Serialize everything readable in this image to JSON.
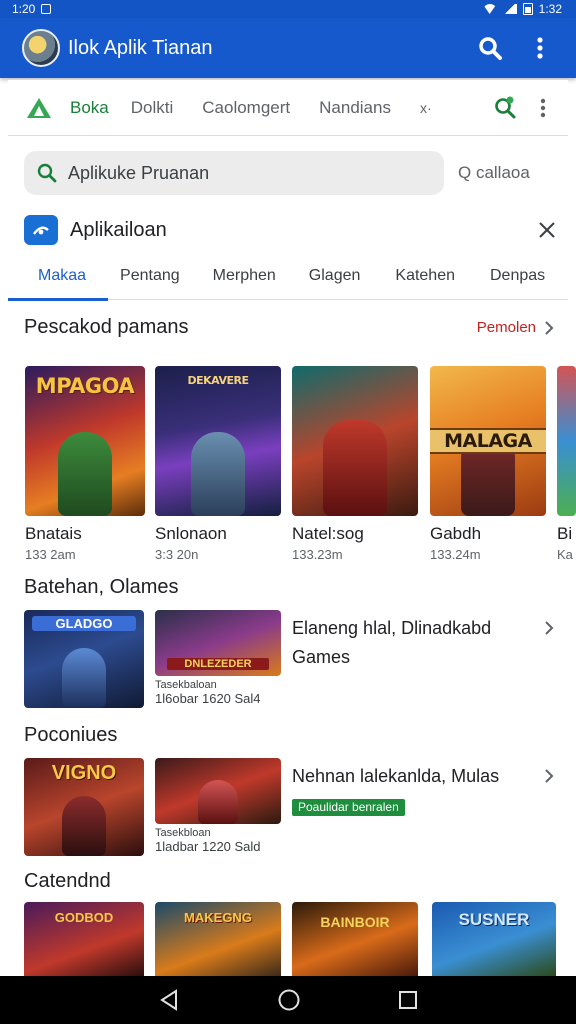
{
  "status_bar": {
    "time": "1:20",
    "clock_right": "1:32"
  },
  "app_bar": {
    "title": "Ilok Aplik Tianan",
    "search_icon": "search-icon",
    "menu_icon": "more-vert-icon",
    "color": "#1659cc"
  },
  "top_tabs": {
    "items": [
      "Boka",
      "Dolkti",
      "Caolomgert",
      "Nandians"
    ],
    "active": "Boka",
    "extra": "x·"
  },
  "search": {
    "placeholder": "Aplikuke Pruanan",
    "side_label": "Q callaoa"
  },
  "panel": {
    "title": "Aplikailoan"
  },
  "category_tabs": [
    "Makaa",
    "Pentang",
    "Merphen",
    "Glagen",
    "Katehen",
    "Denpas"
  ],
  "featured": {
    "title": "Pescakod pamans",
    "more": "Pemolen",
    "cards": [
      {
        "name": "Bnatais",
        "meta": "133 2am",
        "art": "MPAGOA"
      },
      {
        "name": "Snlonaon",
        "meta": "3:3 20n",
        "art": "DEKAVERE"
      },
      {
        "name": "Natel:sog",
        "meta": "133.23m",
        "art": ""
      },
      {
        "name": "Gabdh",
        "meta": "133.24m",
        "art": "MALAGA"
      },
      {
        "name": "Bi",
        "meta": "Ka",
        "art": ""
      }
    ]
  },
  "section_games": {
    "title": "Batehan, Olames",
    "thumb1_art": "GLADGO",
    "thumb2_art": "DNLEZEDER",
    "sub_line1": "Tasekbaloan",
    "sub_line2": "1l6obar 1620 Sal4",
    "info_line1": "Elaneng hlal, Dlinadkabd",
    "info_line2": "Games"
  },
  "section_popular": {
    "title": "Poconiues",
    "thumb1_art": "VIGNO",
    "sub_line1": "Tasekbloan",
    "sub_line2": "1ladbar 1220 Sald",
    "info_line1": "Nehnan lalekanlda, Mulas",
    "badge": "Poaulidar benralen"
  },
  "section_catendnd": {
    "title": "Catendnd",
    "arts": [
      "GODBOD",
      "MAKEGNG",
      "BAINBOIR",
      "SUSNER"
    ]
  },
  "nav": {
    "back": "back-icon",
    "home": "home-icon",
    "recents": "recents-icon"
  },
  "colors": {
    "brand_blue": "#1659cc",
    "active_green": "#188038",
    "link_red": "#c5221f",
    "badge_green": "#1e8e3e"
  }
}
